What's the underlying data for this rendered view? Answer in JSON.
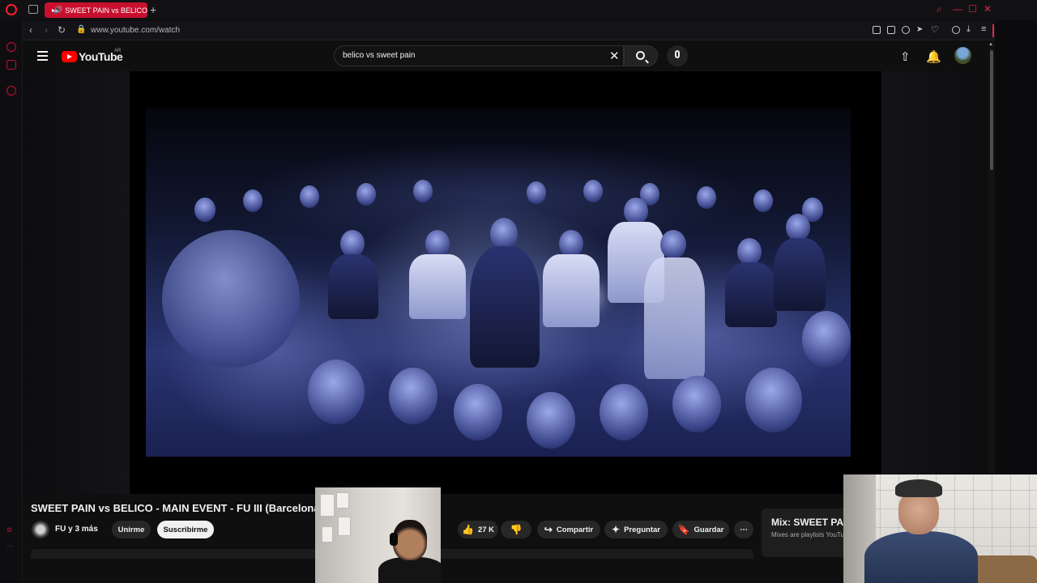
{
  "browser": {
    "tab_title": "SWEET PAIN vs BELICO",
    "url": "www.youtube.com/watch",
    "new_tab": "+",
    "accent_color": "#c8102e"
  },
  "youtube": {
    "logo_text": "YouTube",
    "country_code": "AR",
    "search_query": "belico vs sweet pain"
  },
  "video": {
    "title": "SWEET PAIN vs BELICO - MAIN EVENT - FU III (Barcelona)",
    "channel": "FU y 3 más",
    "join_label": "Unirme",
    "subscribe_label": "Suscribirme",
    "likes": "27 K",
    "share_label": "Compartir",
    "ask_label": "Preguntar",
    "save_label": "Guardar"
  },
  "mix": {
    "title": "Mix: SWEET PAIN vs BELICO",
    "subtitle": "Mixes are playlists YouTube makes for you"
  },
  "icons": {
    "menu": "hamburger-icon",
    "search": "search-icon",
    "mic": "mic-icon",
    "upload": "upload-icon",
    "notifications": "bell-icon"
  }
}
